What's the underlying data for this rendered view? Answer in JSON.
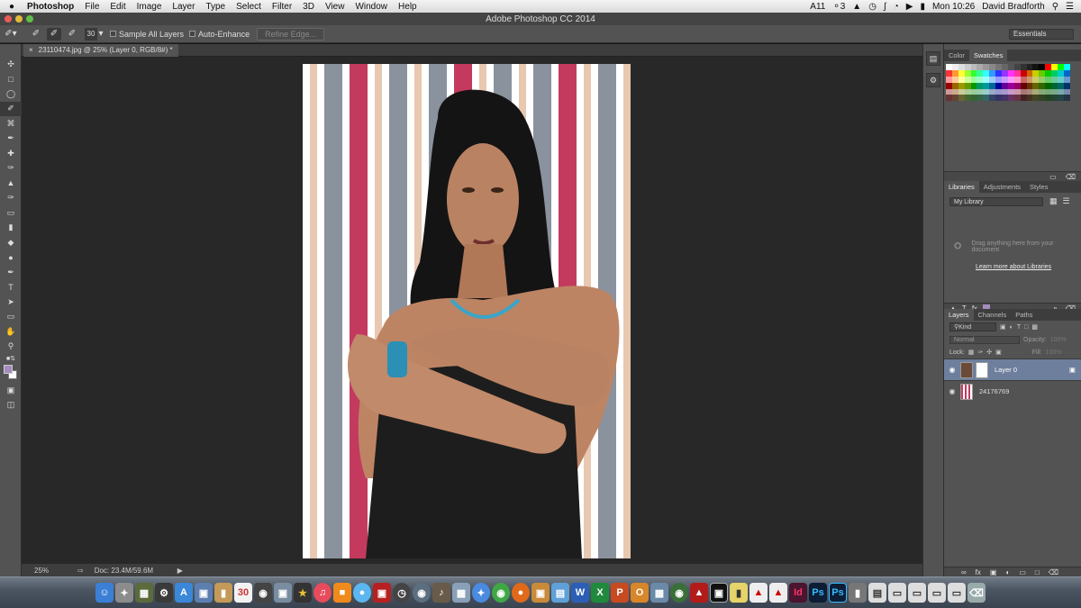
{
  "menubar": {
    "apple_icon": "apple-icon",
    "app_name": "Photoshop",
    "items": [
      "File",
      "Edit",
      "Image",
      "Layer",
      "Type",
      "Select",
      "Filter",
      "3D",
      "View",
      "Window",
      "Help"
    ],
    "status": {
      "ai_count": "11",
      "cc_count": "3",
      "time": "Mon 10:26",
      "user": "David Bradforth"
    }
  },
  "window": {
    "title": "Adobe Photoshop CC 2014"
  },
  "options": {
    "brush_size": "30",
    "sample_all_layers": "Sample All Layers",
    "auto_enhance": "Auto-Enhance",
    "refine_edge": "Refine Edge...",
    "workspace": "Essentials"
  },
  "document": {
    "tab_title": "23110474.jpg @ 25% (Layer 0, RGB/8#) *",
    "close_icon": "×"
  },
  "statusbar": {
    "zoom": "25%",
    "doc_size": "Doc: 23.4M/59.6M"
  },
  "panels": {
    "color": {
      "tabs": [
        "Color",
        "Swatches"
      ],
      "active_tab": "Swatches"
    },
    "libraries": {
      "tabs": [
        "Libraries",
        "Adjustments",
        "Styles"
      ],
      "library_name": "My Library",
      "empty_text": "Drag anything here from your document",
      "link": "Learn more about Libraries"
    },
    "layers": {
      "tabs": [
        "Layers",
        "Channels",
        "Paths"
      ],
      "filter": "Kind",
      "blend_mode": "Normal",
      "opacity_label": "Opacity:",
      "opacity_value": "100%",
      "lock_label": "Lock:",
      "fill_label": "Fill:",
      "fill_value": "100%",
      "items": [
        {
          "name": "Layer 0",
          "selected": true,
          "locked": true
        },
        {
          "name": "24176769",
          "selected": false,
          "locked": false
        }
      ]
    }
  },
  "colors": {
    "stripe_pink": "#c33a5e",
    "stripe_grey": "#8a929d",
    "stripe_peach": "#e8c8b0",
    "selected_layer": "#6d7f9c"
  },
  "dock_calendar_day": "30"
}
